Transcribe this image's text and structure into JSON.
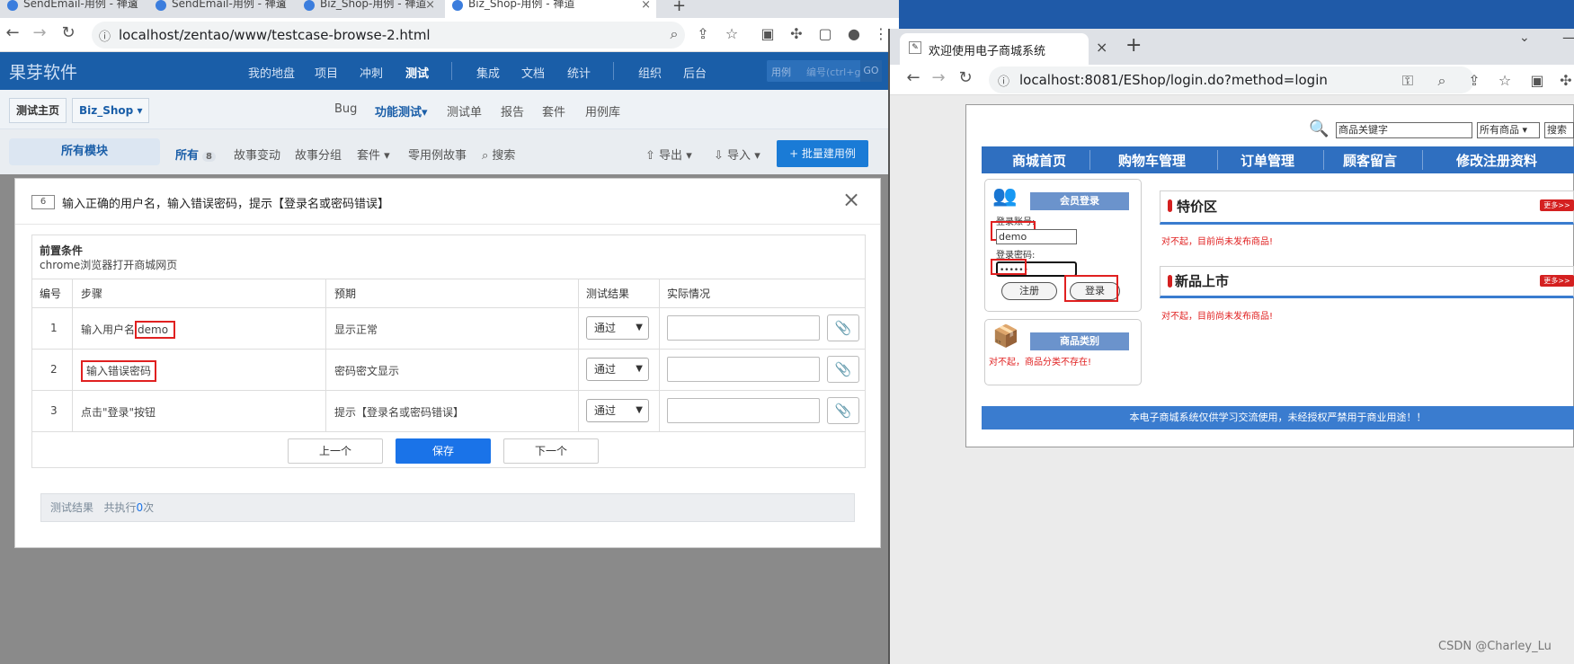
{
  "left_browser": {
    "tabs": [
      "SendEmail-用例 - 禅道",
      "SendEmail-用例 - 禅道",
      "Biz_Shop-用例 - 禅道",
      "Biz_Shop-用例 - 禅道"
    ],
    "new_tab": "+",
    "url": "localhost/zentao/www/testcase-browse-2.html",
    "zentao": {
      "logo": "果芽软件",
      "nav": [
        "我的地盘",
        "项目",
        "冲刺",
        "测试",
        "集成",
        "文档",
        "统计",
        "组织",
        "后台"
      ],
      "search_type": "用例",
      "search_placeholder": "编号(ctrl+g)",
      "search_go": "GO",
      "breadcrumb": [
        "测试主页",
        "Biz_Shop"
      ],
      "subnav": [
        "Bug",
        "功能测试",
        "测试单",
        "报告",
        "套件",
        "用例库"
      ],
      "all_modules": "所有模块",
      "filters": [
        "所有",
        "故事变动",
        "故事分组",
        "套件",
        "零用例故事",
        "搜索"
      ],
      "all_count": "8",
      "export": "导出",
      "import": "导入",
      "batch_create": "+ 批量建用例"
    },
    "modal": {
      "case_id": "6",
      "title": "输入正确的用户名，输入错误密码，提示【登录名或密码错误】",
      "close": "×",
      "precondition_label": "前置条件",
      "precondition": "chrome浏览器打开商城网页",
      "headers": [
        "编号",
        "步骤",
        "预期",
        "测试结果",
        "实际情况"
      ],
      "steps": [
        {
          "no": "1",
          "step_prefix": "输入用户名",
          "step_highlight": "demo",
          "expect": "显示正常",
          "result": "通过"
        },
        {
          "no": "2",
          "step_prefix": "",
          "step_highlight": "输入错误密码",
          "expect": "密码密文显示",
          "result": "通过"
        },
        {
          "no": "3",
          "step_prefix": "点击\"登录\"按钮",
          "step_highlight": "",
          "expect": "提示【登录名或密码错误】",
          "result": "通过"
        }
      ],
      "prev": "上一个",
      "save": "保存",
      "next": "下一个",
      "result_label": "测试结果",
      "result_count_prefix": "共执行",
      "result_count": "0",
      "result_count_suffix": "次"
    }
  },
  "right_browser": {
    "tab_title": "欢迎使用电子商城系统",
    "url": "localhost:8081/EShop/login.do?method=login",
    "shop": {
      "search_value": "商品关键字",
      "category_select": "所有商品",
      "search_btn": "搜索",
      "nav": [
        "商城首页",
        "购物车管理",
        "订单管理",
        "顾客留言",
        "修改注册资料"
      ],
      "login_title": "会员登录",
      "account_label": "登录账号:",
      "account_value": "demo",
      "password_label": "登录密码:",
      "password_value": "••••••",
      "register": "注册",
      "login": "登录",
      "category_title": "商品类别",
      "category_empty": "对不起，商品分类不存在!",
      "special_title": "特价区",
      "special_empty": "对不起，目前尚未发布商品!",
      "new_title": "新品上市",
      "new_empty": "对不起，目前尚未发布商品!",
      "more": "更多>>",
      "footer": "本电子商城系统仅供学习交流使用，未经授权严禁用于商业用途！！"
    }
  },
  "watermark": "CSDN @Charley_Lu",
  "colors": {
    "zentao_blue": "#1a5ea8",
    "primary": "#1a73e8",
    "highlight": "#e02020"
  }
}
